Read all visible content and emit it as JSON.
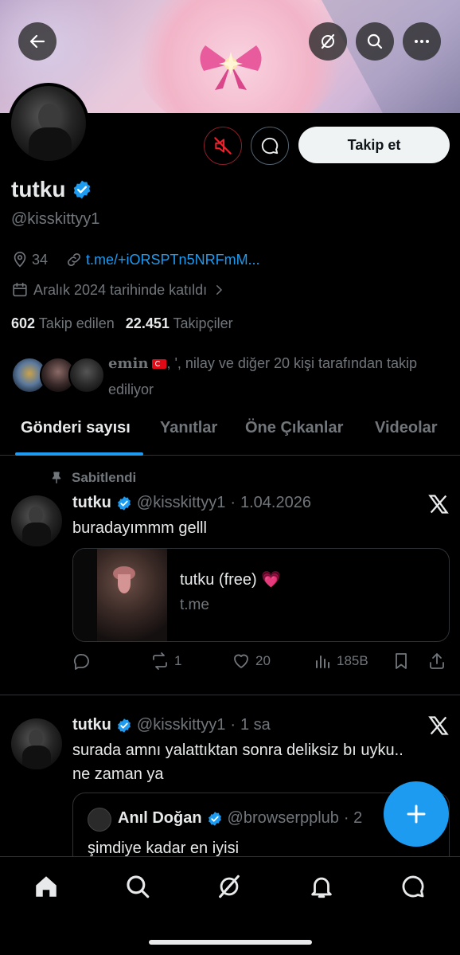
{
  "profile": {
    "display_name": "tutku",
    "handle": "@kisskittyy1",
    "location": "34",
    "link": "t.me/+iORSPTn5NRFmM...",
    "joined": "Aralık 2024 tarihinde katıldı",
    "following_count": "602",
    "following_label": "Takip edilen",
    "followers_count": "22.451",
    "followers_label": "Takipçiler",
    "known_followers_name": "emin",
    "known_followers_rest": ", ', nilay ve diğer 20 kişi tarafından takip ediliyor",
    "follow_button": "Takip et"
  },
  "tabs": [
    "Gönderi sayısı",
    "Yanıtlar",
    "Öne Çıkanlar",
    "Videolar"
  ],
  "posts": [
    {
      "pinned_label": "Sabitlendi",
      "name": "tutku",
      "handle": "@kisskittyy1",
      "sep": "·",
      "time": "1.04.2026",
      "text": "buradayımmm gelll",
      "card_title": "tutku (free) 💗",
      "card_domain": "t.me",
      "retweets": "1",
      "likes": "20",
      "views": "185B"
    },
    {
      "name": "tutku",
      "handle": "@kisskittyy1",
      "sep": "·",
      "time": "1 sa",
      "text_line1": "surada amnı yalattıktan sonra deliksiz bı uyku..",
      "text_line2": "ne zaman ya",
      "quote_name": "Anıl Doğan",
      "quote_handle": "@browserpplub",
      "quote_time": "· 2",
      "quote_text": "şimdiye kadar en iyisi"
    }
  ],
  "icons": {
    "back": "arrow-left-icon",
    "grok": "grok-icon",
    "search": "search-icon",
    "more": "more-icon",
    "verified": "verified-badge-icon",
    "x_logo": "x-logo-icon"
  },
  "colors": {
    "accent": "#1d9bf0",
    "background": "#000000",
    "muted": "#71767b",
    "mute_border": "#8a1f2a"
  }
}
